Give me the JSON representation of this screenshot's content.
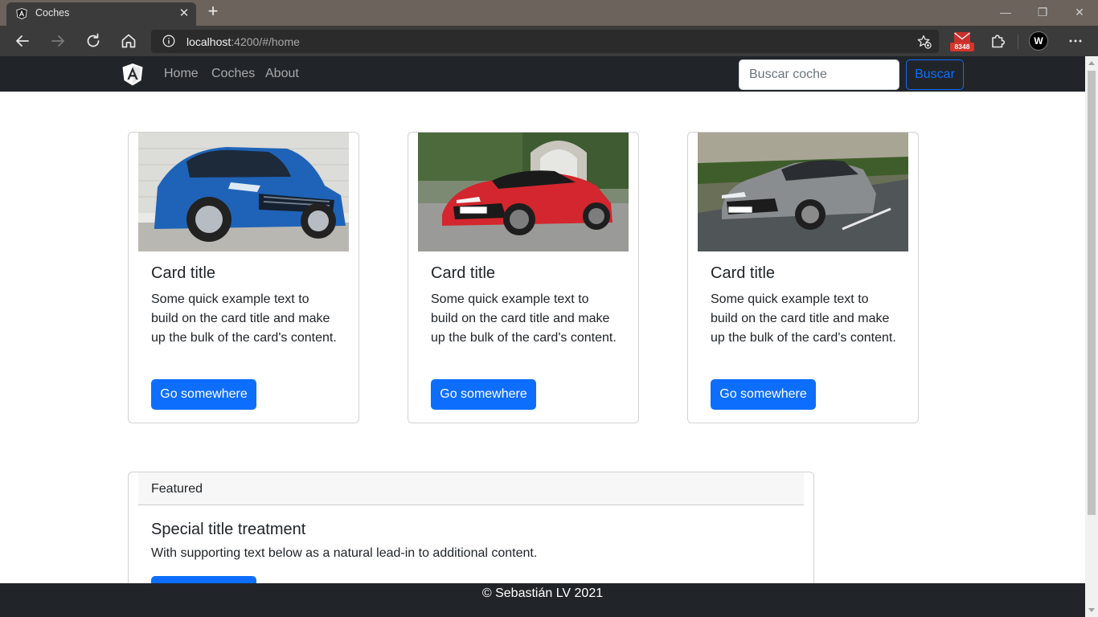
{
  "browser": {
    "tab_title": "Coches",
    "new_tab_symbol": "+",
    "close_symbol": "✕",
    "address_host": "localhost",
    "address_rest": ":4200/#/home",
    "mail_count": "8348",
    "profile_initial": "W",
    "window_controls": [
      "—",
      "❐",
      "✕"
    ]
  },
  "navbar": {
    "links": [
      "Home",
      "Coches",
      "About"
    ],
    "search_placeholder": "Buscar coche",
    "search_button": "Buscar"
  },
  "cards": [
    {
      "image": "blue hatchback car",
      "title": "Card title",
      "text": "Some quick example text to build on the card title and make up the bulk of the card's content.",
      "button": "Go somewhere",
      "colors": {
        "car": "#1f63b8"
      }
    },
    {
      "image": "red sports car",
      "title": "Card title",
      "text": "Some quick example text to build on the card title and make up the bulk of the card's content.",
      "button": "Go somewhere",
      "colors": {
        "car": "#d3262e"
      }
    },
    {
      "image": "grey coupe on road",
      "title": "Card title",
      "text": "Some quick example text to build on the card title and make up the bulk of the card's content.",
      "button": "Go somewhere",
      "colors": {
        "car": "#8a8d90"
      }
    }
  ],
  "featured": {
    "header": "Featured",
    "title": "Special title treatment",
    "text": "With supporting text below as a natural lead-in to additional content."
  },
  "footer": {
    "text": "© Sebastián LV 2021"
  },
  "colors": {
    "navbar_bg": "#212529",
    "primary": "#0d6efd",
    "browser_tabbar": "#6b635c",
    "browser_toolbar": "#3b3b3b"
  }
}
